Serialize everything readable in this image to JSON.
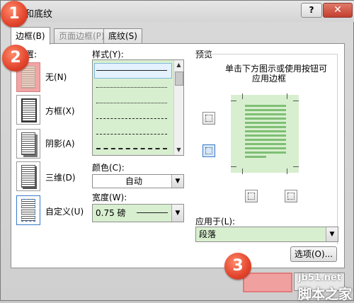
{
  "window": {
    "title": "和底纹",
    "help_label": "?",
    "close_label": "✕"
  },
  "tabs": [
    {
      "label": "边框(B)",
      "active": true
    },
    {
      "label": "页面边框(P)",
      "active": false
    },
    {
      "label": "底纹(S)",
      "active": false
    }
  ],
  "setting": {
    "label": "置:",
    "options": [
      {
        "label": "无(N)",
        "selected": true
      },
      {
        "label": "方框(X)",
        "selected": false
      },
      {
        "label": "阴影(A)",
        "selected": false
      },
      {
        "label": "三维(D)",
        "selected": false
      },
      {
        "label": "自定义(U)",
        "selected": false
      }
    ]
  },
  "style": {
    "label": "样式(Y):",
    "lines": [
      "solid",
      "dotted",
      "dotted",
      "dashed",
      "dashed",
      "dashdot"
    ]
  },
  "color": {
    "label": "颜色(C):",
    "value": "自动"
  },
  "width": {
    "label": "宽度(W):",
    "value": "0.75 磅"
  },
  "preview": {
    "label": "预览",
    "instruction_line1": "单击下方图示或使用按钮可",
    "instruction_line2": "应用边框"
  },
  "apply_to": {
    "label": "应用于(L):",
    "value": "段落"
  },
  "options_button": "选项(O)...",
  "callouts": [
    "1",
    "2",
    "3"
  ],
  "watermark": {
    "line1": "jb51.net",
    "line2": "脚本之家"
  },
  "colors": {
    "accent_red": "#e2442c",
    "list_green": "#d8efcf",
    "highlight_pink": "#f3a4a4"
  }
}
